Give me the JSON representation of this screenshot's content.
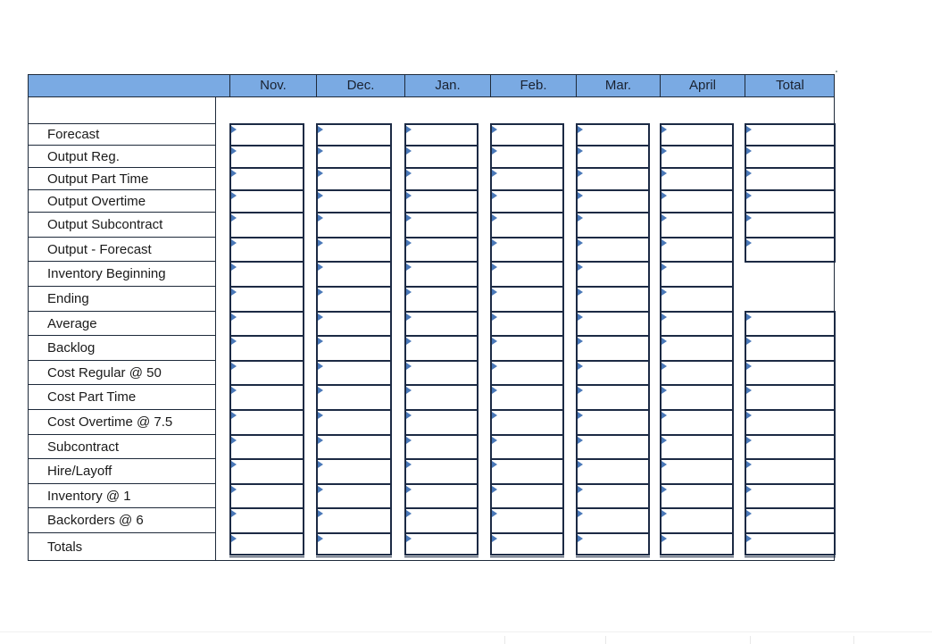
{
  "sheet": {
    "header_columns": [
      "Nov.",
      "Dec.",
      "Jan.",
      "Feb.",
      "Mar.",
      "April",
      "Total"
    ],
    "row_labels": [
      "Forecast",
      "Output Reg.",
      "Output Part Time",
      "Output Overtime",
      "Output Subcontract",
      "Output - Forecast",
      "Inventory Beginning",
      "Ending",
      "Average",
      "Backlog",
      "Cost Regular @ 50",
      "Cost Part Time",
      "Cost Overtime @ 7.5",
      "Subcontract",
      "Hire/Layoff",
      "Inventory @ 1",
      "Backorders @ 6",
      "Totals"
    ],
    "total_column_blank_rows": [
      "Inventory Beginning",
      "Ending"
    ],
    "cell_values": {},
    "colors": {
      "header_fill": "#7aaae3",
      "cell_border": "#1c2a44",
      "input_marker": "#4a78b8"
    }
  }
}
